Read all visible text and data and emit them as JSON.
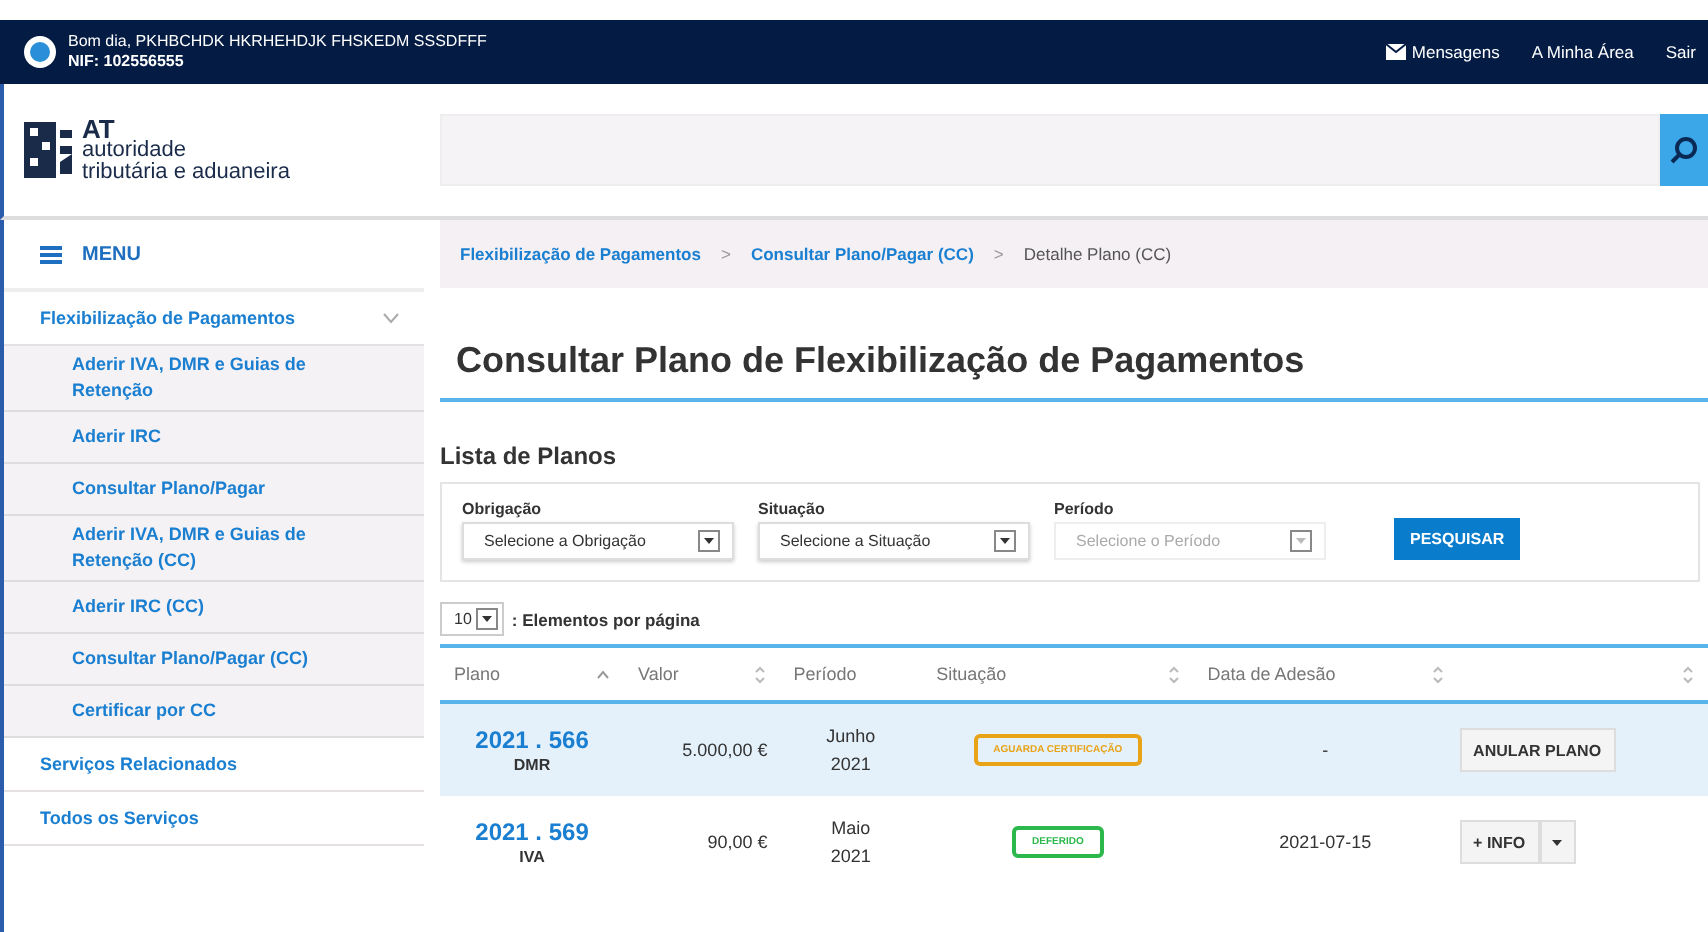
{
  "top_bar": {
    "greeting": "Bom dia, PKHBCHDK HKRHEHDJK FHSKEDM SSSDFFF",
    "nif": "NIF: 102556555",
    "links": [
      {
        "kind": "messages",
        "label": "Mensagens"
      },
      {
        "kind": "plain",
        "label": "A Minha Área"
      },
      {
        "kind": "plain",
        "label": "Sair"
      }
    ]
  },
  "logo": {
    "short": "AT",
    "line_1": "autoridade",
    "line_2": "tributária e aduaneira"
  },
  "sidebar": {
    "menu_label": "MENU",
    "items": [
      {
        "label": "Flexibilização de Pagamentos",
        "expanded": true,
        "children": [
          {
            "label": "Aderir IVA, DMR e Guias de Retenção"
          },
          {
            "label": "Aderir IRC"
          },
          {
            "label": "Consultar Plano/Pagar"
          },
          {
            "label": "Aderir IVA, DMR e Guias de Retenção (CC)"
          },
          {
            "label": "Aderir IRC (CC)"
          },
          {
            "label": "Consultar Plano/Pagar (CC)"
          },
          {
            "label": "Certificar por CC"
          }
        ]
      },
      {
        "label": "Serviços Relacionados"
      },
      {
        "label": "Todos os Serviços"
      }
    ]
  },
  "breadcrumb": [
    {
      "label": "Flexibilização de Pagamentos",
      "link": true
    },
    {
      "separator": ">",
      "label": "Consultar Plano/Pagar (CC)",
      "link": true
    },
    {
      "separator": ">",
      "label": "Detalhe Plano (CC)",
      "link": false
    }
  ],
  "page_title": "Consultar Plano de Flexibilização de Pagamentos",
  "section_title": "Lista de Planos",
  "filters": [
    {
      "label": "Obrigação",
      "placeholder": "Selecione a Obrigação",
      "disabled": false
    },
    {
      "label": "Situação",
      "placeholder": "Selecione a Situação",
      "disabled": false
    },
    {
      "label": "Período",
      "placeholder": "Selecione o Período",
      "disabled": true
    }
  ],
  "search_button": "PESQUISAR",
  "page_size": {
    "value": "10",
    "label": ": Elementos por página"
  },
  "table": {
    "columns": [
      {
        "label": "Plano",
        "sortable": true,
        "sorted": true
      },
      {
        "label": "Valor",
        "sortable": true,
        "sorted": false
      },
      {
        "label": "Período",
        "sortable": false
      },
      {
        "label": "Situação",
        "sortable": true,
        "sorted": false
      },
      {
        "label": "Data de Adesão",
        "sortable": true,
        "sorted": false
      },
      {
        "sortable": true,
        "sorted": false
      }
    ],
    "rows": [
      {
        "selected": true,
        "plan": "2021 . 566",
        "type": "DMR",
        "value": "5.000,00 €",
        "period_1": "Junho",
        "period_2": "2021",
        "status": {
          "label": "AGUARDA CERTIFICAÇÃO",
          "color": "#e8a317"
        },
        "date": "-",
        "action": {
          "kind": "button",
          "label": "ANULAR PLANO"
        }
      },
      {
        "selected": false,
        "plan": "2021 . 569",
        "type": "IVA",
        "value": "90,00 €",
        "period_1": "Maio",
        "period_2": "2021",
        "status": {
          "label": "DEFERIDO",
          "color": "#2db84d"
        },
        "date": "2021-07-15",
        "action": {
          "kind": "split",
          "label": "+ INFO"
        }
      }
    ]
  }
}
